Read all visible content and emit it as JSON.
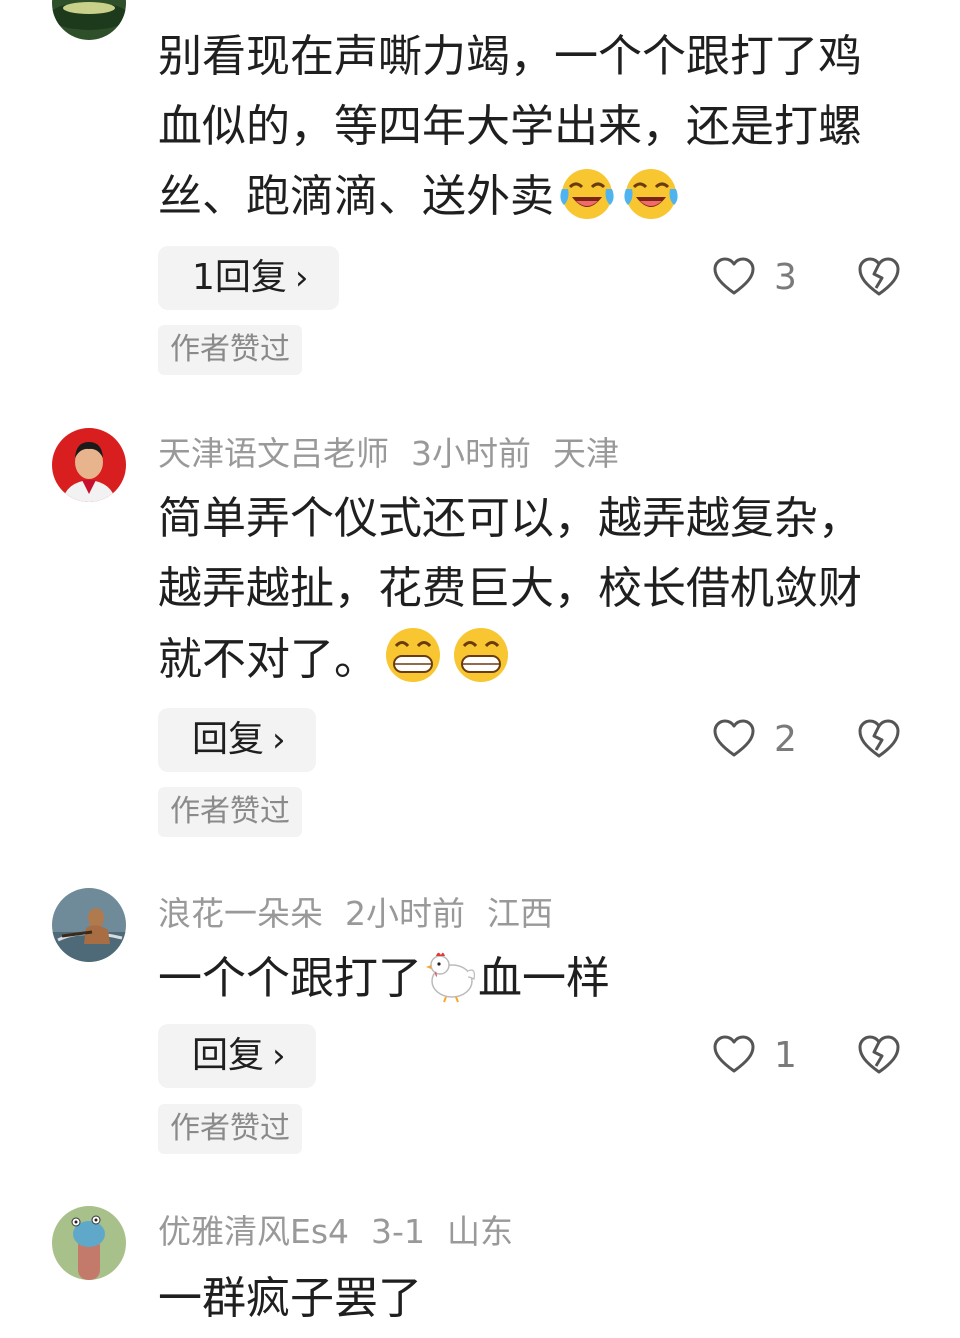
{
  "comments": [
    {
      "user": "",
      "time": "",
      "location": "",
      "text": "别看现在声嘶力竭，一个个跟打了鸡血似的，等四年大学出来，还是打螺丝、跑滴滴、送外卖",
      "emojis": [
        "laughing-crying",
        "laughing-crying"
      ],
      "reply_label": "1回复",
      "reply_chevron": "›",
      "likes": "3",
      "badge": "作者赞过"
    },
    {
      "user": "天津语文吕老师",
      "time": "3小时前",
      "location": "天津",
      "text": "简单弄个仪式还可以，越弄越复杂，越弄越扯，花费巨大，校长借机敛财就不对了。",
      "emojis": [
        "grinning",
        "grinning"
      ],
      "reply_label": "回复",
      "reply_chevron": "›",
      "likes": "2",
      "badge": "作者赞过"
    },
    {
      "user": "浪花一朵朵",
      "time": "2小时前",
      "location": "江西",
      "text_before": "一个个跟打了",
      "emoji_inline": "chicken",
      "text_after": "血一样",
      "reply_label": "回复",
      "reply_chevron": "›",
      "likes": "1",
      "badge": "作者赞过"
    },
    {
      "user": "优雅清风Es4",
      "time": "3-1",
      "location": "山东",
      "text": "一群疯子罢了"
    }
  ],
  "colors": {
    "meta_text": "#999999",
    "body_text": "#1f1f1f",
    "button_bg": "#f3f3f3",
    "badge_text": "#8a8a8a"
  }
}
